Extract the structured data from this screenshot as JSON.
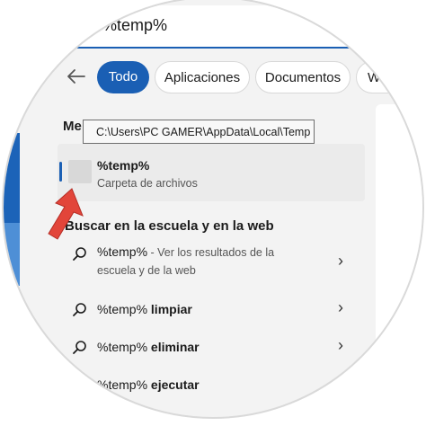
{
  "search": {
    "query": "%temp%"
  },
  "tabs": [
    {
      "label": "Todo"
    },
    {
      "label": "Aplicaciones"
    },
    {
      "label": "Documentos"
    },
    {
      "label": "W"
    }
  ],
  "best_match": {
    "heading": "Me",
    "tooltip": "C:\\Users\\PC GAMER\\AppData\\Local\\Temp",
    "title": "%temp%",
    "subtitle": "Carpeta de archivos"
  },
  "web_section": {
    "heading": "Buscar en la escuela y en la web"
  },
  "results": [
    {
      "main": "%temp%",
      "suffix": " - Ver los resultados de la",
      "line2": "escuela y de la web"
    },
    {
      "main": "%temp%",
      "bold": " limpiar"
    },
    {
      "main": "%temp%",
      "bold": " eliminar"
    },
    {
      "main": "%temp%",
      "bold": " ejecutar"
    }
  ],
  "colors": {
    "accent": "#1a5fb4",
    "arrow": "#e2453a"
  }
}
